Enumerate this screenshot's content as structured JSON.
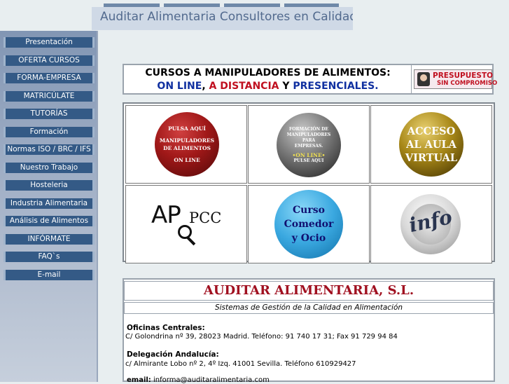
{
  "header": {
    "site_title": "Auditar Alimentaria Consultores en Calidad"
  },
  "sidebar": {
    "items": [
      {
        "label": "Presentación"
      },
      {
        "label": "OFERTA CURSOS"
      },
      {
        "label": "FORMA-EMPRESA"
      },
      {
        "label": "MATRICÚLATE"
      },
      {
        "label": "TUTORÍAS"
      },
      {
        "label": "Formación"
      },
      {
        "label": "Normas ISO / BRC / IFS"
      },
      {
        "label": "Nuestro Trabajo"
      },
      {
        "label": "Hosteleria"
      },
      {
        "label": "Industria Alimentaria"
      },
      {
        "label": "Análisis de Alimentos"
      },
      {
        "label": "INFÓRMATE"
      },
      {
        "label": "FAQ`s"
      },
      {
        "label": "E-mail"
      }
    ]
  },
  "promo": {
    "line1": "CURSOS A MANIPULADORES DE ALIMENTOS:",
    "online": "ON LINE",
    "sep1": ", ",
    "distancia": "A DISTANCIA",
    "sep2": " Y ",
    "presenciales": "PRESENCIALES.",
    "presupuesto_l1": "PRESUPUESTO",
    "presupuesto_l2": "SIN COMPROMISO"
  },
  "grid": {
    "manip_1": "PULSA AQUÍ",
    "manip_2": "MANIPULADORES",
    "manip_3": "DE ALIMENTOS",
    "manip_4": "ON LINE",
    "empresas_1": "FORMACIÓN DE",
    "empresas_2": "MANIPULADORES",
    "empresas_3": "PARA",
    "empresas_4": "EMPRESAS.",
    "empresas_5": "•ON LINE•",
    "empresas_6": "PULSE AQUI",
    "aula_1": "ACCESO",
    "aula_2": "AL AULA",
    "aula_3": "VIRTUAL",
    "appcc_ap": "AP",
    "appcc_pcc": "PCC",
    "curso_1": "Curso",
    "curso_2": "Comedor",
    "curso_3": "y Ocio",
    "info": "info"
  },
  "company": {
    "name": "AUDITAR ALIMENTARIA, S.L.",
    "subtitle": "Sistemas de Gestión de la Calidad en Alimentación",
    "central_title": "Oficinas Centrales:",
    "central_addr": "C/ Golondrina nº 39, 28023 Madrid. Teléfono: 91 740 17 31; Fax 91 729 94 84",
    "andalucia_title": "Delegación Andalucía:",
    "andalucia_addr": "c/ Almirante Lobo nº 2, 4º Izq. 41001 Sevilla. Teléfono 610929427",
    "email_label": "email:",
    "email_value": "informa@auditaralimentaria.com"
  },
  "colors": {
    "nav_button": "#345a86",
    "title_text": "#526a8e",
    "promo_blue": "#1030a0",
    "promo_red": "#c01020",
    "company_red": "#a01020"
  }
}
